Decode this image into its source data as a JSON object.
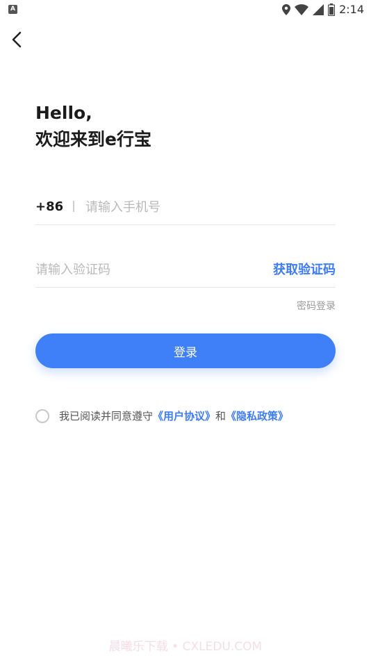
{
  "status_bar": {
    "notification_letter": "A",
    "time": "2:14",
    "icons": [
      "location-icon",
      "wifi-icon",
      "signal-icon",
      "battery-icon"
    ]
  },
  "header": {
    "back_icon": "chevron-left-icon"
  },
  "greeting": {
    "line1": "Hello,",
    "line2": "欢迎来到e行宝"
  },
  "phone": {
    "country_code": "+86",
    "placeholder": "请输入手机号"
  },
  "code": {
    "placeholder": "请输入验证码",
    "get_code_label": "获取验证码"
  },
  "password_login_label": "密码登录",
  "login_button_label": "登录",
  "agreement": {
    "prefix": "我已阅读并同意遵守",
    "user_agreement": "《用户协议》",
    "and": "和",
    "privacy_policy": "《隐私政策》"
  },
  "watermark": "晨曦乐下载 • CXLEDU.COM",
  "colors": {
    "accent": "#3f80f8",
    "link": "#3f7cf3",
    "placeholder": "#b9b9b9",
    "divider": "#e4e4e4"
  }
}
